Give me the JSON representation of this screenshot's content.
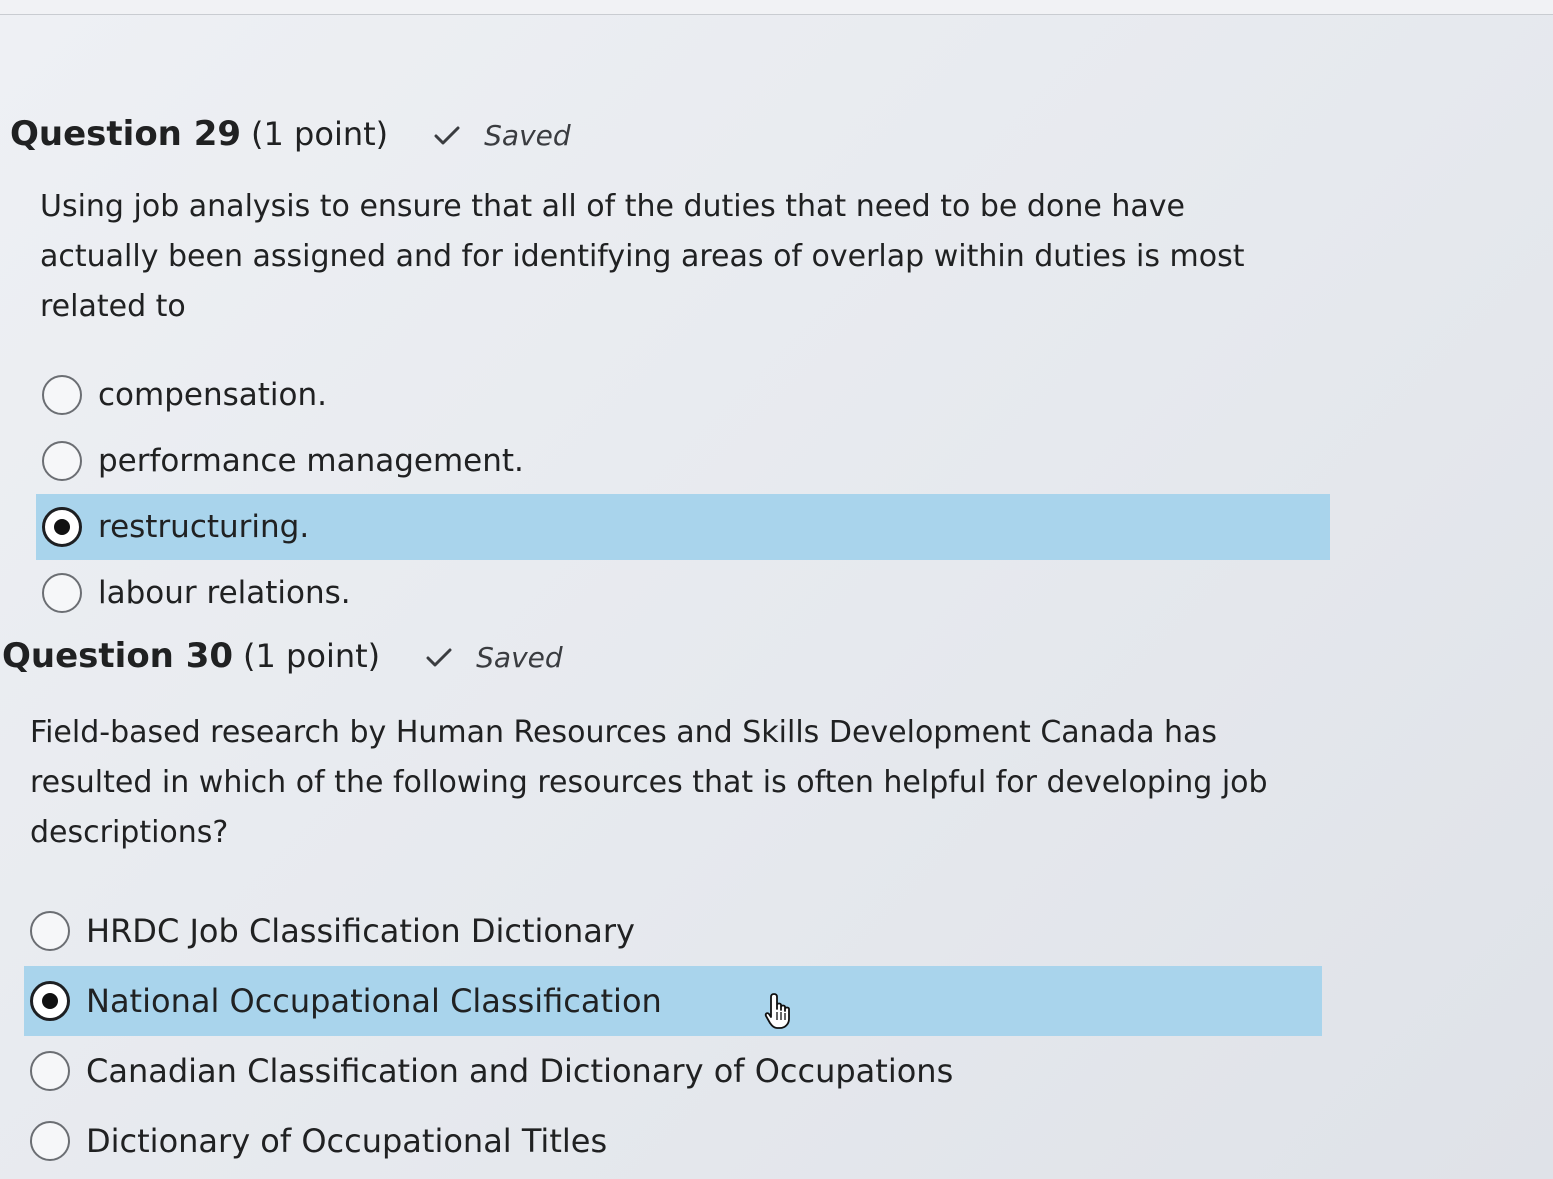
{
  "questions": [
    {
      "title": "Question 29",
      "points": "(1 point)",
      "status": "Saved",
      "text": "Using job analysis to ensure that all of the duties that need to be done have actually been assigned and for identifying areas of overlap within duties is most related to",
      "options": [
        {
          "label": "compensation.",
          "selected": false
        },
        {
          "label": "performance management.",
          "selected": false
        },
        {
          "label": "restructuring.",
          "selected": true
        },
        {
          "label": "labour relations.",
          "selected": false
        }
      ]
    },
    {
      "title": "Question 30",
      "points": "(1 point)",
      "status": "Saved",
      "text": "Field-based research by Human Resources and Skills Development Canada has resulted in which of the following resources that is often helpful for developing job descriptions?",
      "options": [
        {
          "label": "HRDC Job Classification Dictionary",
          "selected": false
        },
        {
          "label": "National Occupational Classification",
          "selected": true
        },
        {
          "label": "Canadian Classification and Dictionary of Occupations",
          "selected": false
        },
        {
          "label": "Dictionary of Occupational Titles",
          "selected": false
        }
      ]
    }
  ],
  "colors": {
    "selected_row": "#a9d4ec",
    "text": "#202122"
  },
  "icons": [
    "check-icon",
    "radio-button-icon",
    "hand-pointer-cursor-icon"
  ]
}
